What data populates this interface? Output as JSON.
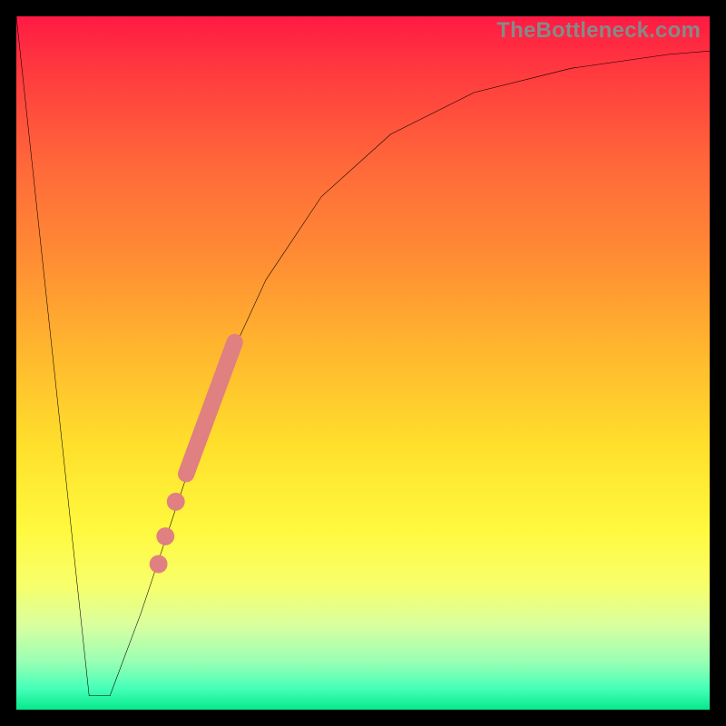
{
  "watermark": "TheBottleneck.com",
  "chart_data": {
    "type": "line",
    "title": "",
    "xlabel": "",
    "ylabel": "",
    "xlim": [
      0,
      100
    ],
    "ylim": [
      0,
      100
    ],
    "grid": false,
    "legend": false,
    "series": [
      {
        "name": "curve-left-descent",
        "x": [
          0,
          10.5
        ],
        "y": [
          100,
          2
        ]
      },
      {
        "name": "curve-floor",
        "x": [
          10.5,
          13.5
        ],
        "y": [
          2,
          2
        ]
      },
      {
        "name": "curve-right-rise",
        "x": [
          13.5,
          18,
          22,
          26,
          30,
          36,
          44,
          54,
          66,
          80,
          94,
          100
        ],
        "y": [
          2,
          14,
          26,
          38,
          49,
          62,
          74,
          83,
          89,
          92.5,
          94.5,
          95
        ]
      }
    ],
    "markers": {
      "name": "highlight-segment",
      "color": "#e08080",
      "thick_segment": {
        "x": [
          24.5,
          31.5
        ],
        "y": [
          34,
          53
        ]
      },
      "dots": [
        {
          "x": 23.0,
          "y": 30
        },
        {
          "x": 21.5,
          "y": 25
        },
        {
          "x": 20.5,
          "y": 21
        }
      ],
      "dot_radius": 1.3
    }
  }
}
